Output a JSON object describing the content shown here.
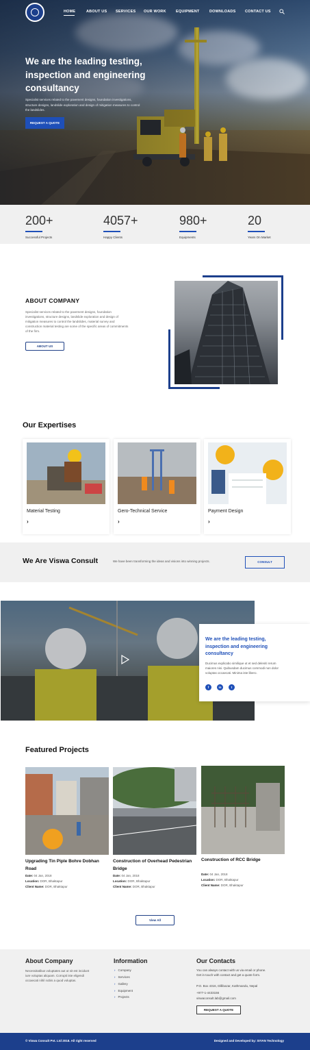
{
  "nav": {
    "items": [
      "HOME",
      "ABOUT US",
      "SERVICES",
      "OUR WORK",
      "EQUIPMENT",
      "DOWNLOADS",
      "CONTACT US"
    ],
    "active": "HOME"
  },
  "hero": {
    "title": "We are the leading testing, inspection and engineering consultancy",
    "description": "Specialist services related to the pavement designs, foundation investigations, structure designs, landslide exploration and design of mitigation measures to control the landslides.",
    "button": "REQUEST A QUOTE"
  },
  "stats": [
    {
      "value": "200+",
      "label": "Successful Projects"
    },
    {
      "value": "4057+",
      "label": "Happy Clients"
    },
    {
      "value": "980+",
      "label": "Equipments"
    },
    {
      "value": "20",
      "label": "Years On Market"
    }
  ],
  "about": {
    "title": "ABOUT COMPANY",
    "description": "Specialist services related to the pavement designs, foundation investigations, structure designs, landslide exploration and design of mitigation measures to control the landslides, material survey and construction material testing are some of the specific areas of commitments of the firm.",
    "button": "ABOUT US"
  },
  "expertises": {
    "title": "Our Expertises",
    "cards": [
      {
        "title": "Material Testing"
      },
      {
        "title": "Gero-Technical Service"
      },
      {
        "title": "Payment Design"
      }
    ]
  },
  "band": {
    "title": "We Are Viswa Consult",
    "description": "We have been transforming the ideas and visions into winning projects.",
    "button": "CONSULT"
  },
  "video": {
    "card_title": "We are the leading testing, inspection and engineering consultancy",
    "card_description": "Ducimus explicabo similique ut et sed deleniti rerum maiores nisi. Quibusdam ducimus commodi non dolor voluptas occaecati. Minima iste libero.",
    "social": [
      "f",
      "in",
      "t"
    ]
  },
  "featured": {
    "title": "Featured Projects",
    "projects": [
      {
        "title": "Upgrading Tin Piple Bohre Dobhan Road",
        "date": "04 Jan, 2018",
        "location": "DOR, Bhaktapur",
        "client": "DOR, Bhaktapur"
      },
      {
        "title": "Construction of Overhead Pedestrian Bridge",
        "date": "04 Jan, 2018",
        "location": "DOR, Bhaktapur",
        "client": "DOR, Bhaktapur"
      },
      {
        "title": "Construction of RCC Bridge",
        "date": "04 Jan, 2018",
        "location": "DOR, Bhaktapur",
        "client": "DOR, Bhaktapur"
      }
    ],
    "labels": {
      "date": "Date:",
      "location": "Location:",
      "client": "Client Name:"
    },
    "view_all": "View All"
  },
  "footer": {
    "about_title": "About Company",
    "about_text": "Necessitatibus voluptates aut ut sit est incidunt iure voluptas aliquam. Corrupti iste eligendi occaecati nihil nobis a quod voluptas.",
    "info_title": "Information",
    "info_links": [
      "Company",
      "Services",
      "Gallery",
      "Equipment",
      "Projects"
    ],
    "contacts_title": "Our Contacts",
    "contacts_intro_1": "You can always contact with us via email or phone.",
    "contacts_intro_2": "Get in touch with contact and get a quote form.",
    "address": "P.O. Box 4316, Dillibazar, Kathmandu, Nepal",
    "phone": "+977-1-4433156",
    "email": "viswaconsult.lab@gmail.com",
    "quote_button": "REQUEST A QUOTE",
    "copyright": "© Viswa Consult Pvt. Ltd 2018. All right reserved",
    "designed_by": "Designed and Developed by: SIYAN Technology"
  }
}
